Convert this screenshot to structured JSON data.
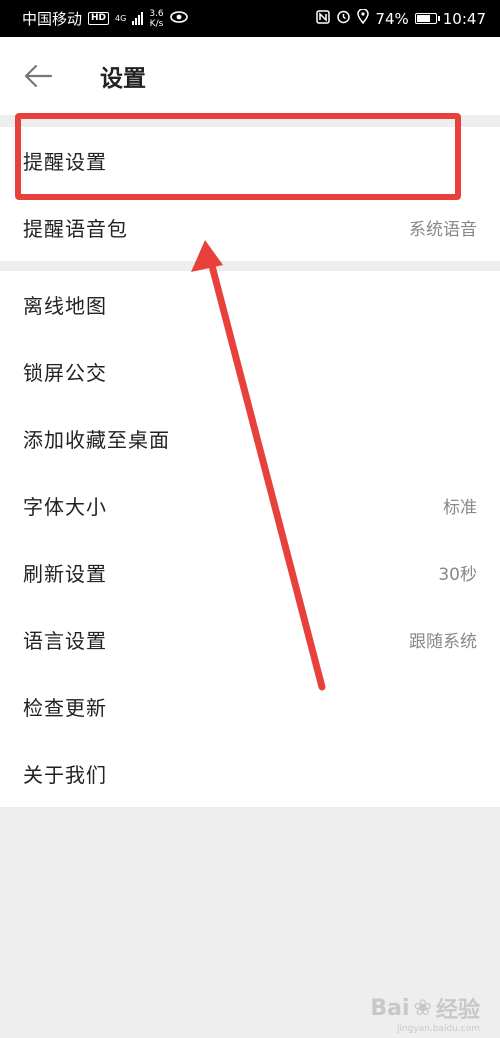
{
  "status_bar": {
    "carrier": "中国移动",
    "hd": "HD",
    "network": "4G",
    "speed_value": "3.6",
    "speed_unit": "K/s",
    "battery": "74%",
    "time": "10:47"
  },
  "header": {
    "title": "设置"
  },
  "group1": [
    {
      "label": "提醒设置",
      "value": ""
    },
    {
      "label": "提醒语音包",
      "value": "系统语音"
    }
  ],
  "group2": [
    {
      "label": "离线地图",
      "value": ""
    },
    {
      "label": "锁屏公交",
      "value": ""
    },
    {
      "label": "添加收藏至桌面",
      "value": ""
    },
    {
      "label": "字体大小",
      "value": "标准"
    },
    {
      "label": "刷新设置",
      "value": "30秒"
    },
    {
      "label": "语言设置",
      "value": "跟随系统"
    },
    {
      "label": "检查更新",
      "value": ""
    },
    {
      "label": "关于我们",
      "value": ""
    }
  ],
  "annotation": {
    "color": "#e8413c"
  },
  "watermark": {
    "brand": "Bai",
    "brand_suffix": "经验",
    "url": "jingyan.baidu.com"
  }
}
